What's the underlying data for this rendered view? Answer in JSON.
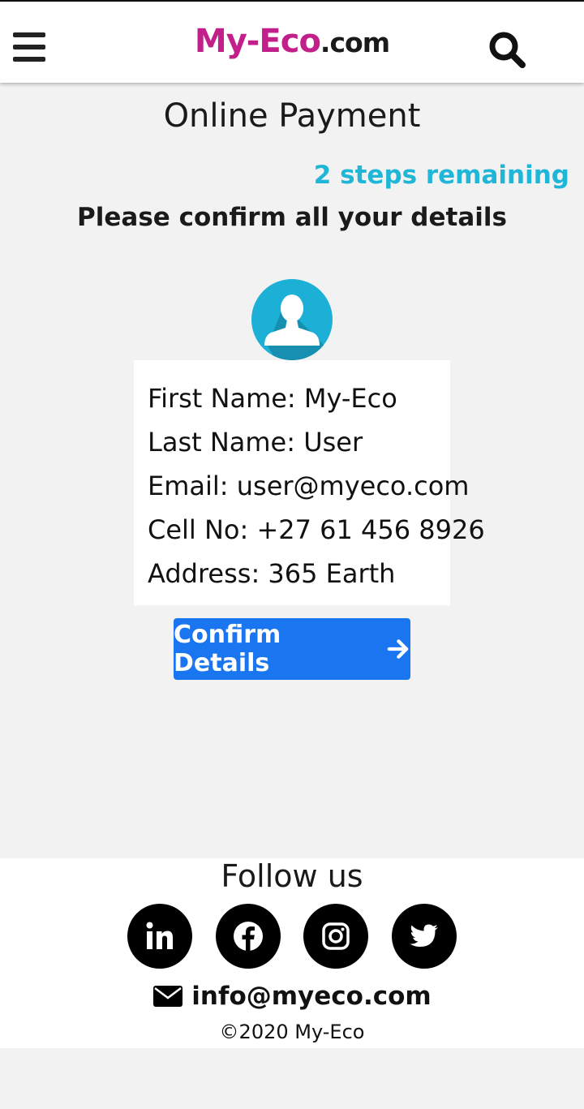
{
  "header": {
    "brand_primary": "My-Eco",
    "brand_suffix": ".com",
    "menu_icon": "hamburger-menu-icon",
    "search_icon": "search-icon"
  },
  "page": {
    "title": "Online Payment",
    "steps_remaining": "2 steps remaining",
    "subtitle": "Please confirm all your details"
  },
  "details": {
    "avatar_icon": "user-avatar-icon",
    "rows": [
      "First Name: My-Eco",
      "Last Name: User",
      "Email: user@myeco.com",
      "Cell No: +27 61 456 8926",
      "Address: 365 Earth"
    ]
  },
  "confirm_button": {
    "label": "Confirm Details",
    "icon": "arrow-right-icon"
  },
  "footer": {
    "follow_label": "Follow us",
    "social": [
      "linkedin-icon",
      "facebook-icon",
      "instagram-icon",
      "twitter-icon"
    ],
    "email": "info@myeco.com",
    "copyright": "©2020 My-Eco"
  },
  "colors": {
    "brand_pink": "#c21f8a",
    "accent_cyan": "#1fb6d8",
    "button_blue": "#1976f0",
    "background": "#f2f2f2"
  }
}
